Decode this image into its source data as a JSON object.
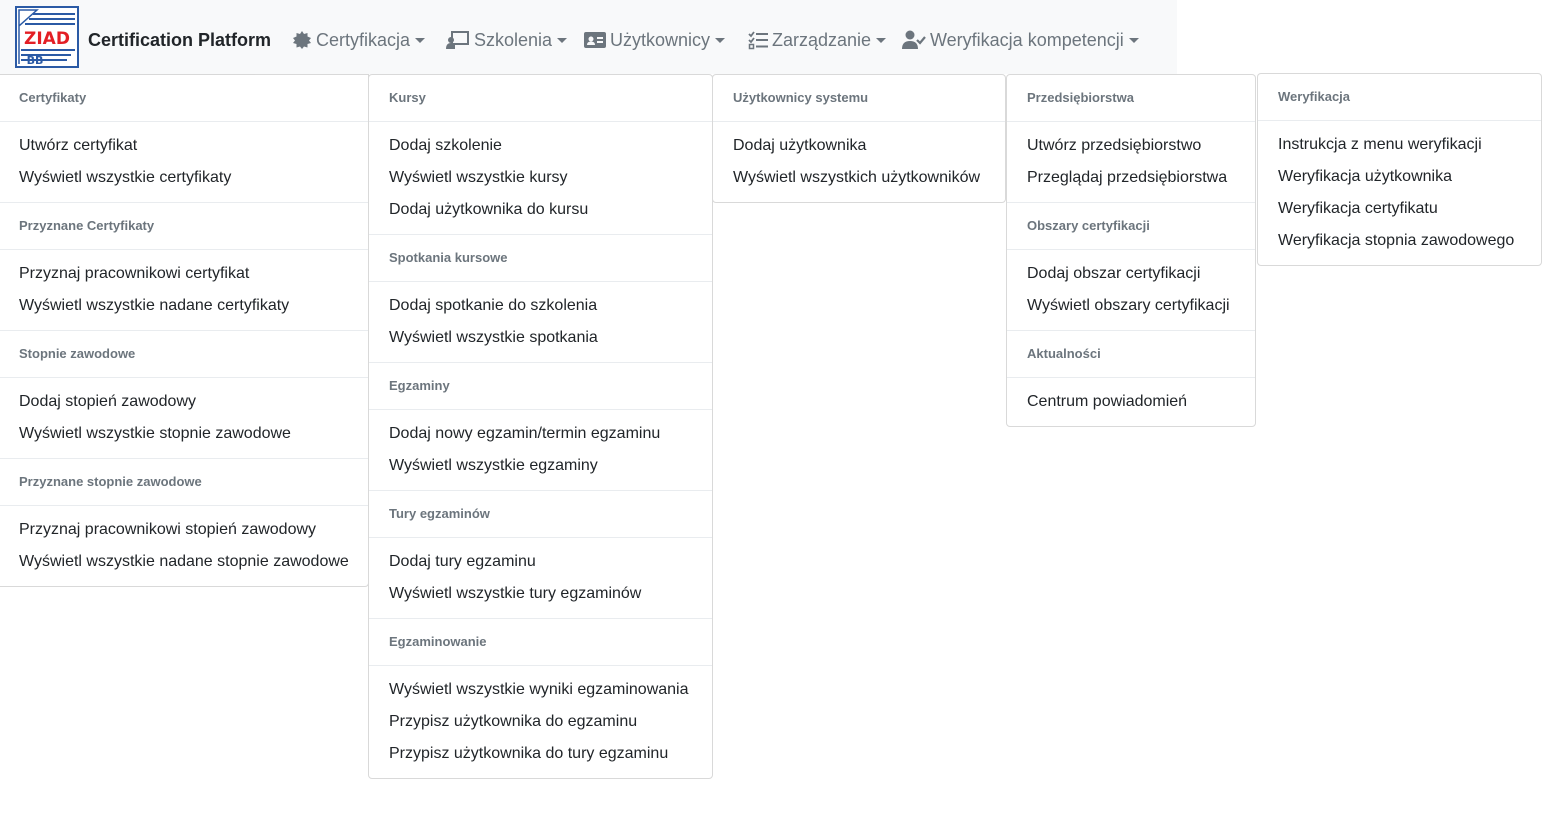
{
  "brand": {
    "title": "Certification Platform",
    "logo_text_top": "ZIAD",
    "logo_text_bottom": "BB"
  },
  "colors": {
    "navbar_bg": "#f8f9fa",
    "nav_text": "#6c757d",
    "header_text": "#6c757d",
    "item_text": "#212529",
    "logo_red": "#e31e24",
    "logo_blue": "#2b5aa5"
  },
  "nav": [
    {
      "label": "Certyfikacja",
      "icon": "certificate-icon"
    },
    {
      "label": "Szkolenia",
      "icon": "chalkboard-teacher-icon"
    },
    {
      "label": "Użytkownicy",
      "icon": "id-card-icon"
    },
    {
      "label": "Zarządzanie",
      "icon": "tasks-icon"
    },
    {
      "label": "Weryfikacja kompetencji",
      "icon": "user-check-icon"
    }
  ],
  "menus": {
    "certyfikacja": [
      {
        "header": "Certyfikaty",
        "items": [
          "Utwórz certyfikat",
          "Wyświetl wszystkie certyfikaty"
        ]
      },
      {
        "header": "Przyznane Certyfikaty",
        "items": [
          "Przyznaj pracownikowi certyfikat",
          "Wyświetl wszystkie nadane certyfikaty"
        ]
      },
      {
        "header": "Stopnie zawodowe",
        "items": [
          "Dodaj stopień zawodowy",
          "Wyświetl wszystkie stopnie zawodowe"
        ]
      },
      {
        "header": "Przyznane stopnie zawodowe",
        "items": [
          "Przyznaj pracownikowi stopień zawodowy",
          "Wyświetl wszystkie nadane stopnie zawodowe"
        ]
      }
    ],
    "szkolenia": [
      {
        "header": "Kursy",
        "items": [
          "Dodaj szkolenie",
          "Wyświetl wszystkie kursy",
          "Dodaj użytkownika do kursu"
        ]
      },
      {
        "header": "Spotkania kursowe",
        "items": [
          "Dodaj spotkanie do szkolenia",
          "Wyświetl wszystkie spotkania"
        ]
      },
      {
        "header": "Egzaminy",
        "items": [
          "Dodaj nowy egzamin/termin egzaminu",
          "Wyświetl wszystkie egzaminy"
        ]
      },
      {
        "header": "Tury egzaminów",
        "items": [
          "Dodaj tury egzaminu",
          "Wyświetl wszystkie tury egzaminów"
        ]
      },
      {
        "header": "Egzaminowanie",
        "items": [
          "Wyświetl wszystkie wyniki egzaminowania",
          "Przypisz użytkownika do egzaminu",
          "Przypisz użytkownika do tury egzaminu"
        ]
      }
    ],
    "uzytkownicy": [
      {
        "header": "Użytkownicy systemu",
        "items": [
          "Dodaj użytkownika",
          "Wyświetl wszystkich użytkowników"
        ]
      }
    ],
    "zarzadzanie": [
      {
        "header": "Przedsiębiorstwa",
        "items": [
          "Utwórz przedsiębiorstwo",
          "Przeglądaj przedsiębiorstwa"
        ]
      },
      {
        "header": "Obszary certyfikacji",
        "items": [
          "Dodaj obszar certyfikacji",
          "Wyświetl obszary certyfikacji"
        ]
      },
      {
        "header": "Aktualności",
        "items": [
          "Centrum powiadomień"
        ]
      }
    ],
    "weryfikacja": [
      {
        "header": "Weryfikacja",
        "items": [
          "Instrukcja z menu weryfikacji",
          "Weryfikacja użytkownika",
          "Weryfikacja certyfikatu",
          "Weryfikacja stopnia zawodowego"
        ]
      }
    ]
  }
}
